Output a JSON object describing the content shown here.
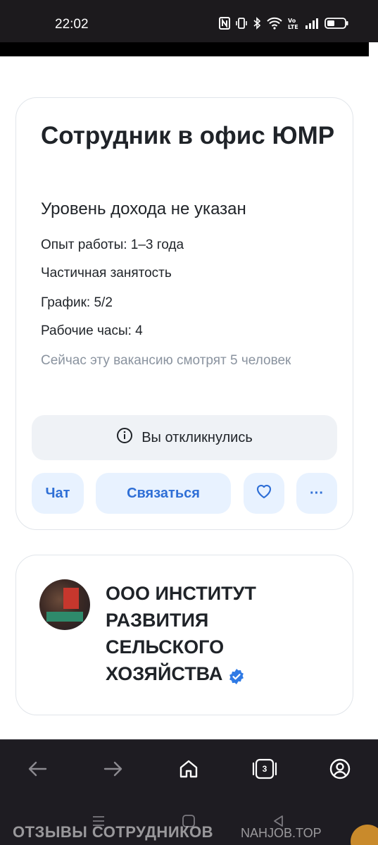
{
  "status_bar": {
    "time": "22:02",
    "icons": [
      "nfc-icon",
      "vibrate-icon",
      "bluetooth-icon",
      "wifi-icon",
      "volte-icon",
      "signal-icon",
      "battery-icon"
    ]
  },
  "vacancy": {
    "title": "Сотрудник в офис ЮМР",
    "salary": "Уровень дохода не указан",
    "experience": "Опыт работы: 1–3 года",
    "employment": "Частичная занятость",
    "schedule": "График: 5/2",
    "hours": "Рабочие часы: 4",
    "viewers": "Сейчас эту вакансию смотрят 5 человек",
    "applied_label": "Вы откликнулись",
    "chat_label": "Чат",
    "contact_label": "Связаться",
    "more_label": "···"
  },
  "company": {
    "name": "ООО ИНСТИТУТ РАЗВИТИЯ СЕЛЬСКОГО ХОЗЯЙСТВА"
  },
  "browser_nav": {
    "tabs_count": "3"
  },
  "watermark": {
    "left": "ОТЗЫВЫ СОТРУДНИКОВ",
    "right": "NAHJOB.TOP"
  },
  "colors": {
    "accent": "#2f6fd6",
    "accent_bg": "#e8f2ff",
    "muted": "#8a939f",
    "verified": "#2f7ae5",
    "bar_bg": "#1e1c22"
  }
}
